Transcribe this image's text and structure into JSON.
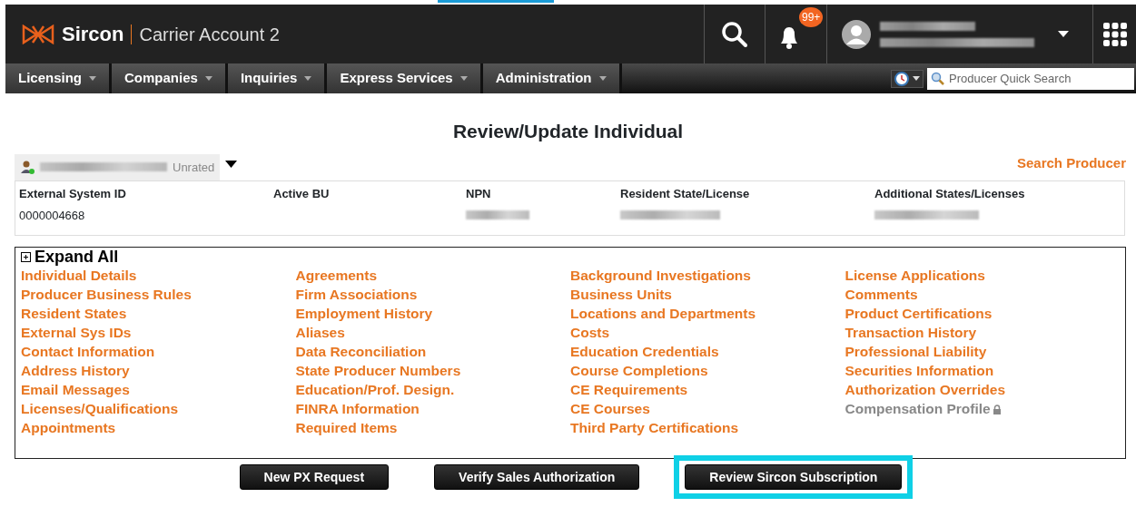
{
  "header": {
    "brand": "Sircon",
    "account": "Carrier Account 2",
    "notification_count": "99+"
  },
  "nav": [
    {
      "label": "Licensing"
    },
    {
      "label": "Companies"
    },
    {
      "label": "Inquiries"
    },
    {
      "label": "Express Services"
    },
    {
      "label": "Administration"
    }
  ],
  "quick_search": {
    "placeholder": "Producer Quick Search"
  },
  "page_title": "Review/Update Individual",
  "producer": {
    "rating": "Unrated"
  },
  "search_producer": "Search Producer",
  "summary": {
    "columns": [
      {
        "label": "External System ID",
        "value": "0000004668"
      },
      {
        "label": "Active BU"
      },
      {
        "label": "NPN",
        "redacted": true
      },
      {
        "label": "Resident State/License",
        "redacted": true
      },
      {
        "label": "Additional States/Licenses",
        "redacted": true
      }
    ]
  },
  "expand_all": "Expand All",
  "link_columns": [
    [
      {
        "label": "Individual Details",
        "disabled": false
      },
      {
        "label": "Producer Business Rules",
        "disabled": false
      },
      {
        "label": "Resident States",
        "disabled": false
      },
      {
        "label": "External Sys IDs",
        "disabled": false
      },
      {
        "label": "Contact Information",
        "disabled": false
      },
      {
        "label": "Address History",
        "disabled": false
      },
      {
        "label": "Email Messages",
        "disabled": false
      },
      {
        "label": "Licenses/Qualifications",
        "disabled": false
      },
      {
        "label": "Appointments",
        "disabled": false
      }
    ],
    [
      {
        "label": "Agreements",
        "disabled": false
      },
      {
        "label": "Firm Associations",
        "disabled": false
      },
      {
        "label": "Employment History",
        "disabled": false
      },
      {
        "label": "Aliases",
        "disabled": false
      },
      {
        "label": "Data Reconciliation",
        "disabled": false
      },
      {
        "label": "State Producer Numbers",
        "disabled": false
      },
      {
        "label": "Education/Prof. Design.",
        "disabled": false
      },
      {
        "label": "FINRA Information",
        "disabled": false
      },
      {
        "label": "Required Items",
        "disabled": false
      }
    ],
    [
      {
        "label": "Background Investigations",
        "disabled": false
      },
      {
        "label": "Business Units",
        "disabled": false
      },
      {
        "label": "Locations and Departments",
        "disabled": false
      },
      {
        "label": "Costs",
        "disabled": false
      },
      {
        "label": "Education Credentials",
        "disabled": false
      },
      {
        "label": "Course Completions",
        "disabled": false
      },
      {
        "label": "CE Requirements",
        "disabled": false
      },
      {
        "label": "CE Courses",
        "disabled": false
      },
      {
        "label": "Third Party Certifications",
        "disabled": false
      }
    ],
    [
      {
        "label": "License Applications",
        "disabled": false
      },
      {
        "label": "Comments",
        "disabled": false
      },
      {
        "label": "Product Certifications",
        "disabled": false
      },
      {
        "label": "Transaction History",
        "disabled": false
      },
      {
        "label": "Professional Liability",
        "disabled": false
      },
      {
        "label": "Securities Information",
        "disabled": false
      },
      {
        "label": "Authorization Overrides",
        "disabled": false
      },
      {
        "label": "Compensation Profile",
        "disabled": true
      }
    ]
  ],
  "buttons": [
    {
      "label": "New PX Request",
      "highlighted": false
    },
    {
      "label": "Verify Sales Authorization",
      "highlighted": false
    },
    {
      "label": "Review Sircon Subscription",
      "highlighted": true
    }
  ]
}
